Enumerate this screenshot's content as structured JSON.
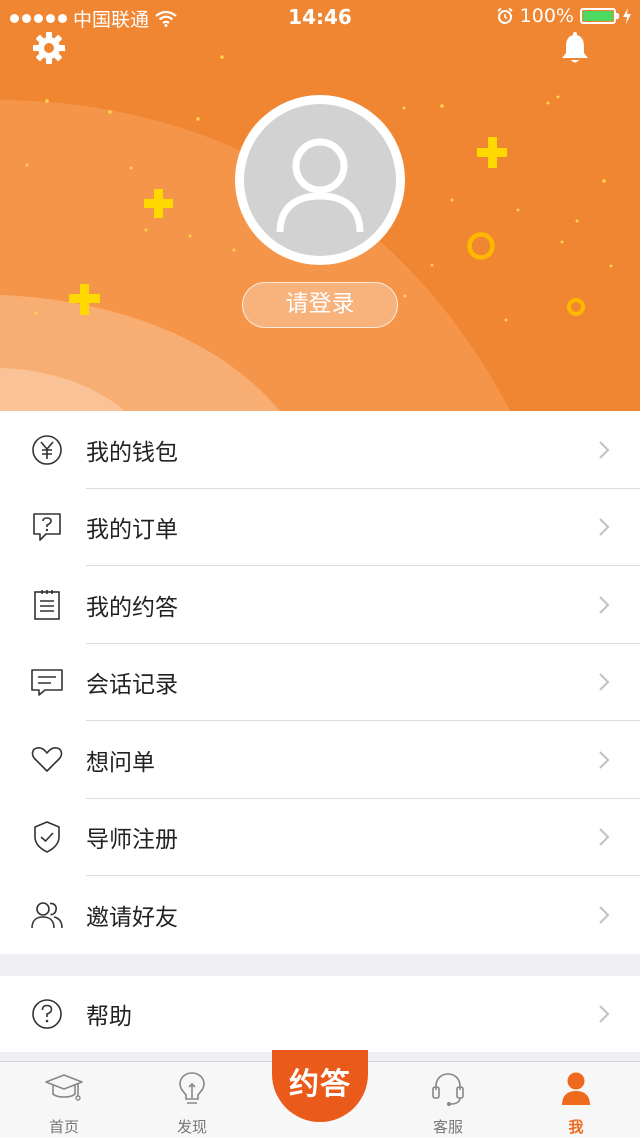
{
  "status_bar": {
    "carrier": "中国联通",
    "time": "14:46",
    "battery": "100%"
  },
  "header": {
    "settings_icon": "gear-icon",
    "notification_icon": "bell-icon",
    "avatar_icon": "user-placeholder-icon",
    "login_label": "请登录",
    "accent_color": "#f08532"
  },
  "menu": {
    "items": [
      {
        "label": "我的钱包",
        "icon": "wallet-yuan-icon"
      },
      {
        "label": "我的订单",
        "icon": "question-bubble-icon"
      },
      {
        "label": "我的约答",
        "icon": "clipboard-icon"
      },
      {
        "label": "会话记录",
        "icon": "chat-icon"
      },
      {
        "label": "想问单",
        "icon": "heart-icon"
      },
      {
        "label": "导师注册",
        "icon": "shield-check-icon"
      },
      {
        "label": "邀请好友",
        "icon": "users-icon"
      }
    ],
    "help_label": "帮助"
  },
  "tabbar": {
    "tabs": [
      {
        "label": "首页",
        "icon": "graduation-cap-icon"
      },
      {
        "label": "发现",
        "icon": "lightbulb-icon"
      },
      {
        "label": "约答",
        "icon": "center-action"
      },
      {
        "label": "客服",
        "icon": "headset-icon"
      },
      {
        "label": "我",
        "icon": "person-icon"
      }
    ],
    "active_color": "#f06a1e"
  }
}
